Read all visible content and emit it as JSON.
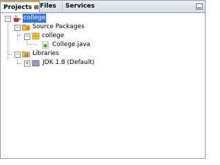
{
  "tabs": [
    {
      "label": "Projects",
      "close": "⊠"
    },
    {
      "label": "Files"
    },
    {
      "label": "Services"
    }
  ],
  "tree": {
    "project": "college",
    "source_packages": "Source Packages",
    "package": "college",
    "file": "College.java",
    "libraries": "Libraries",
    "jdk": "JDK 1.8 (Default)"
  },
  "colors": {
    "selection": "#3875d7",
    "active_tab_accent": "#f29a3b"
  }
}
